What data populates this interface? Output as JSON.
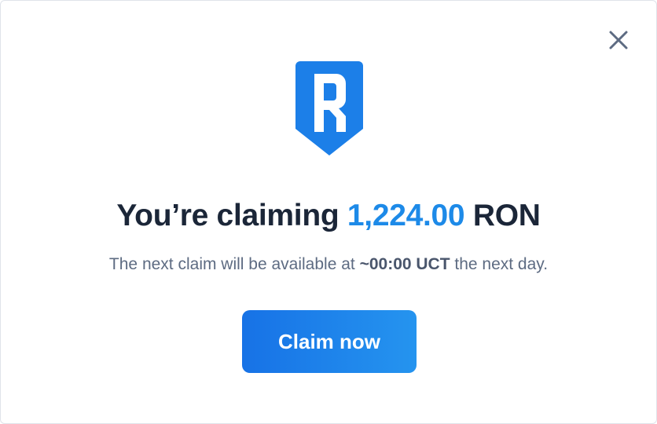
{
  "dialog": {
    "title": {
      "prefix": "You’re claiming ",
      "amount": "1,224.00",
      "suffix": " RON"
    },
    "subtitle": {
      "before": "The next claim will be available at ",
      "time": "~00:00 UCT",
      "after": " the next day."
    },
    "claim_button_label": "Claim now",
    "icons": {
      "close": "close-icon",
      "logo": "ronin-logo-icon"
    },
    "colors": {
      "accent": "#1d8ae8",
      "button_start": "#1772e6",
      "button_end": "#2594ef",
      "logo": "#1c7fe8",
      "title": "#1b2638"
    }
  }
}
